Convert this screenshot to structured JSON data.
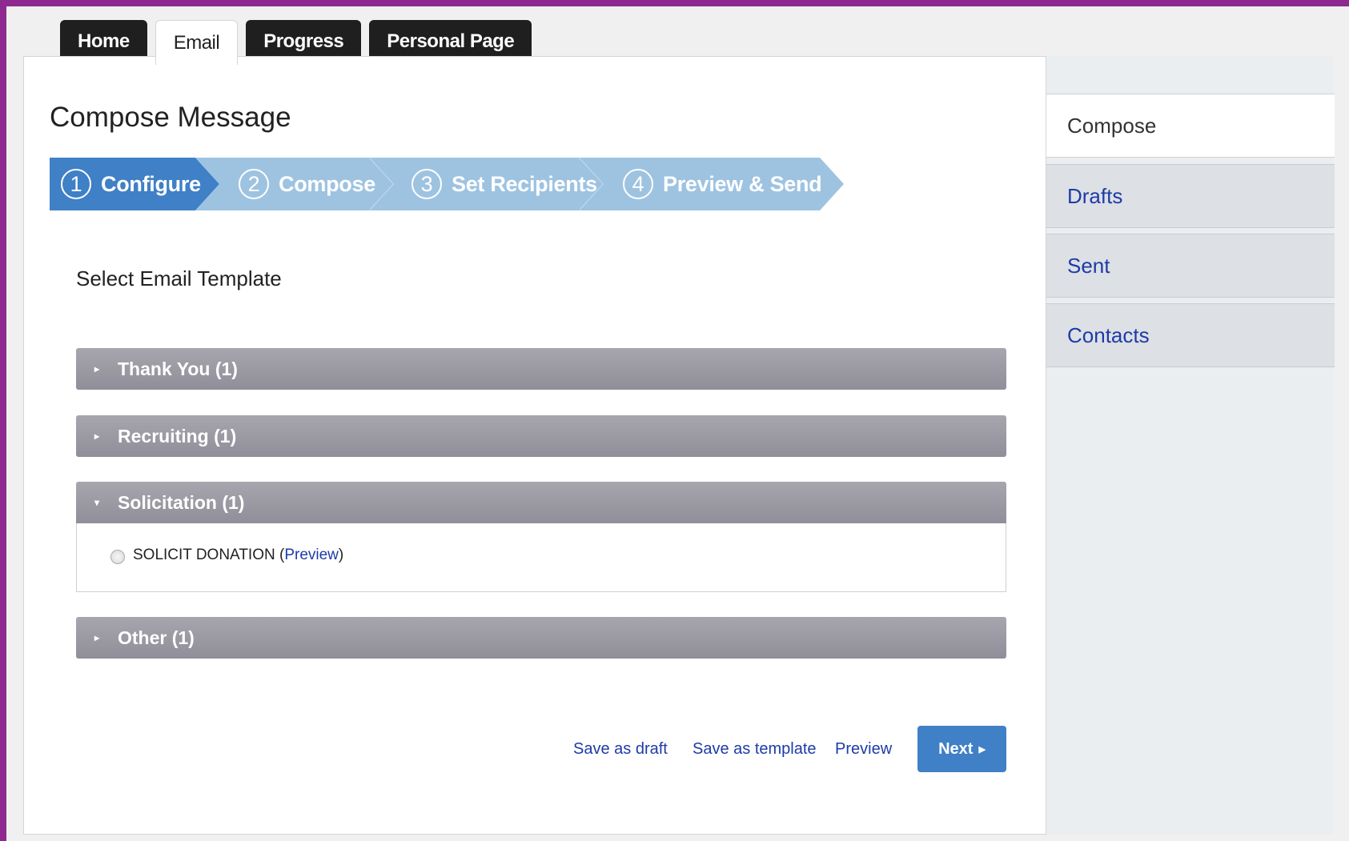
{
  "top_tabs": [
    "Home",
    "Email",
    "Progress",
    "Personal Page"
  ],
  "page_title": "Compose Message",
  "steps": [
    {
      "num": "1",
      "label": "Configure"
    },
    {
      "num": "2",
      "label": "Compose"
    },
    {
      "num": "3",
      "label": "Set Recipients"
    },
    {
      "num": "4",
      "label": "Preview & Send"
    }
  ],
  "section_label": "Select Email Template",
  "categories": [
    {
      "label": "Thank You (1)"
    },
    {
      "label": "Recruiting (1)"
    },
    {
      "label": "Solicitation (1)"
    },
    {
      "label": "Other (1)"
    }
  ],
  "template": {
    "name": "SOLICIT DONATION",
    "open_paren": "(",
    "preview_link": "Preview",
    "close_paren": ")"
  },
  "actions": {
    "save_draft": "Save as draft",
    "save_template": "Save as template",
    "preview": "Preview",
    "next": "Next"
  },
  "sidebar": [
    "Compose",
    "Drafts",
    "Sent",
    "Contacts"
  ],
  "colors": {
    "frame": "#8e2a8f",
    "step_active": "#3f80c7",
    "step_inactive": "#9ec3e1",
    "accordion": "#9d9ba5",
    "link": "#1e3ba8"
  }
}
